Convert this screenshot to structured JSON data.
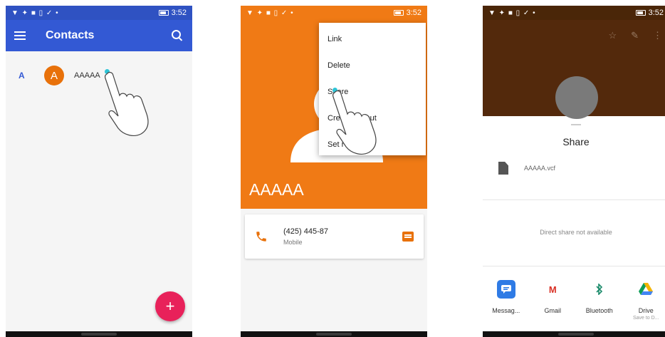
{
  "status_bar": {
    "time": "3:52",
    "left_icons": "▼ ✦ ■ ▯ ✓ •"
  },
  "screen1": {
    "title": "Contacts",
    "section_letter": "A",
    "avatar_letter": "A",
    "contact_name": "AAAAA",
    "fab_label": "+"
  },
  "screen2": {
    "contact_name": "AAAAA",
    "menu_items": [
      "Link",
      "Delete",
      "Share",
      "Create shortcut",
      "Set ringtone"
    ],
    "menu_items_visible": [
      "Link",
      "Delete",
      "Share",
      "Crea    hortcut",
      "Set r"
    ],
    "phone_number": "(425) 445-87",
    "phone_type": "Mobile"
  },
  "screen3": {
    "sheet_title": "Share",
    "file_name": "AAAAA.vcf",
    "direct_share_text": "Direct share not available",
    "apps": [
      {
        "label": "Messag...",
        "sub": "",
        "icon": "messages-icon",
        "color": "#2f7be5"
      },
      {
        "label": "Gmail",
        "sub": "",
        "icon": "gmail-icon",
        "color": "#d93025"
      },
      {
        "label": "Bluetooth",
        "sub": "",
        "icon": "bluetooth-icon",
        "color": "#1a8a6a"
      },
      {
        "label": "Drive",
        "sub": "Save to D...",
        "icon": "drive-icon",
        "color": "#f4b400"
      }
    ]
  },
  "colors": {
    "contacts_blue": "#3359d4",
    "contact_orange": "#f07a15",
    "header_brown": "#53290c",
    "fab_pink": "#e8215a",
    "tap_dot": "#2ec4d6"
  }
}
